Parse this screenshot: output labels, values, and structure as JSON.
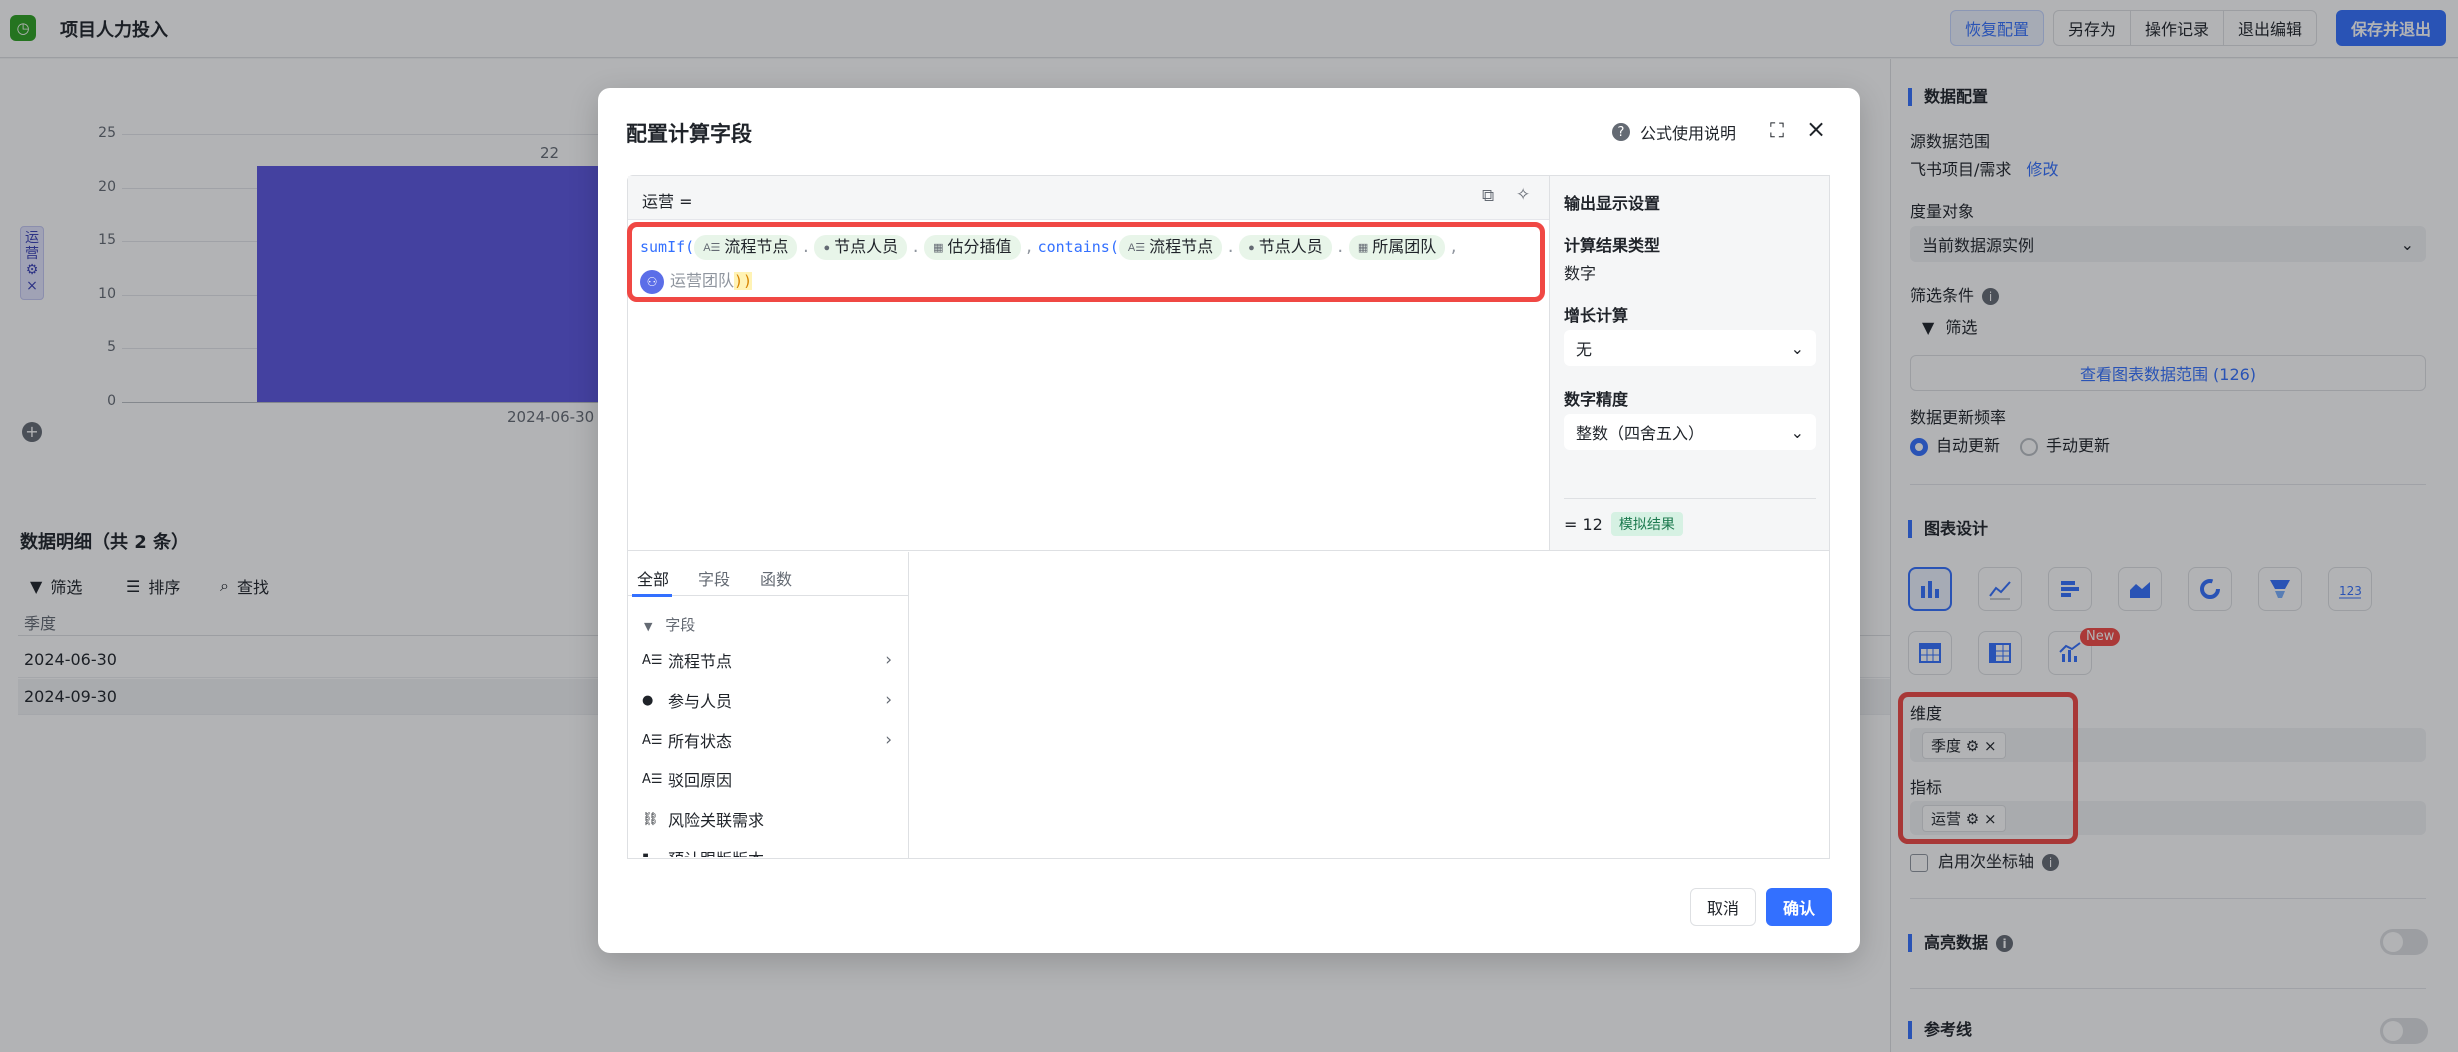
{
  "topbar": {
    "title": "项目人力投入",
    "restore": "恢复配置",
    "save_as": "另存为",
    "history": "操作记录",
    "exit_edit": "退出编辑",
    "save_exit": "保存并退出"
  },
  "chart_data": {
    "type": "bar",
    "categories": [
      "2024-06-30"
    ],
    "series": [
      {
        "name": "运营",
        "values": [
          22
        ]
      }
    ],
    "yticks": [
      "25",
      "20",
      "15",
      "10",
      "5",
      "0"
    ],
    "ylim": [
      0,
      25
    ],
    "bar_label": "22",
    "color": "#5b55e0"
  },
  "series_chip": {
    "label": "运营"
  },
  "detail": {
    "title": "数据明细（共 2 条）",
    "filter": "筛选",
    "sort": "排序",
    "find": "查找",
    "column": "季度",
    "rows": [
      "2024-06-30",
      "2024-09-30"
    ]
  },
  "right": {
    "data_config": "数据配置",
    "source_label": "源数据范围",
    "source_value": "飞书项目/需求",
    "modify": "修改",
    "measure_label": "度量对象",
    "measure_value": "当前数据源实例",
    "filter_label": "筛选条件",
    "filter_btn": "筛选",
    "view_range": "查看图表数据范围 (126)",
    "freq_label": "数据更新频率",
    "auto": "自动更新",
    "manual": "手动更新",
    "chart_design": "图表设计",
    "new_badge": "New",
    "dim_label": "维度",
    "dim_tag": "季度",
    "metric_label": "指标",
    "metric_tag": "运营",
    "secondary_axis": "启用次坐标轴",
    "highlight": "高亮数据",
    "refline": "参考线"
  },
  "modal": {
    "title": "配置计算字段",
    "help": "公式使用说明",
    "editor_label": "运营 =",
    "formula": {
      "fn1": "sumIf(",
      "chip1": "流程节点",
      "chip2": "节点人员",
      "chip3": "估分插值",
      "fn2": "contains(",
      "chip4": "流程节点",
      "chip5": "节点人员",
      "chip6": "所属团队",
      "team": "运营团队"
    },
    "output_title": "输出显示设置",
    "result_type_label": "计算结果类型",
    "result_type_value": "数字",
    "growth_label": "增长计算",
    "growth_value": "无",
    "precision_label": "数字精度",
    "precision_value": "整数（四舍五入）",
    "sim_value": "= 12",
    "sim_tag": "模拟结果",
    "tabs": [
      "全部",
      "字段",
      "函数"
    ],
    "group": "字段",
    "fields": [
      "流程节点",
      "参与人员",
      "所有状态",
      "驳回原因",
      "风险关联需求",
      "预计跟版版本"
    ],
    "cancel": "取消",
    "confirm": "确认"
  }
}
